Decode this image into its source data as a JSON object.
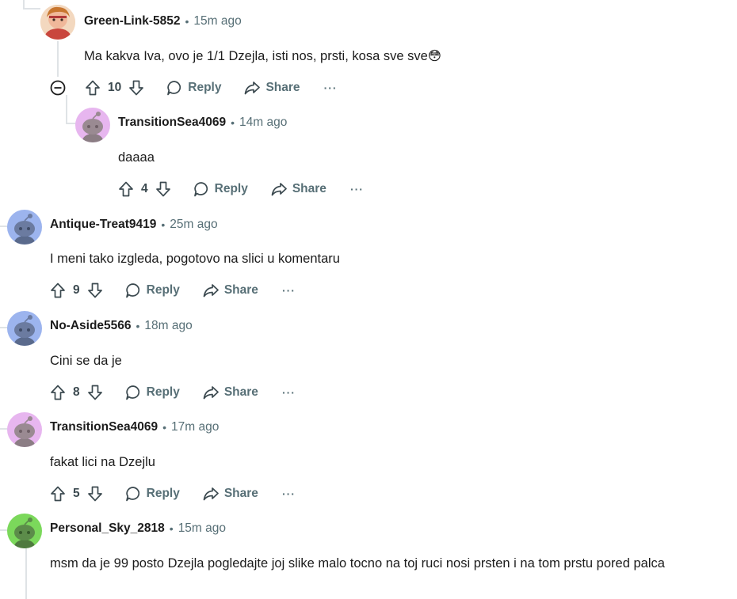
{
  "comments": [
    {
      "username": "Green-Link-5852",
      "time": "15m ago",
      "text": "Ma kakva Iva, ovo je 1/1 Dzejla, isti nos, prsti, kosa sve sve😳",
      "votes": "10",
      "avatar_color": "#f0c9a4"
    },
    {
      "username": "TransitionSea4069",
      "time": "14m ago",
      "text": "daaaa",
      "votes": "4",
      "avatar_color": "#e7b6ef"
    },
    {
      "username": "Antique-Treat9419",
      "time": "25m ago",
      "text": "I meni tako izgleda, pogotovo na slici u komentaru",
      "votes": "9",
      "avatar_color": "#9cb4ee"
    },
    {
      "username": "No-Aside5566",
      "time": "18m ago",
      "text": "Cini se da je",
      "votes": "8",
      "avatar_color": "#9cb4ee"
    },
    {
      "username": "TransitionSea4069",
      "time": "17m ago",
      "text": "fakat lici na Dzejlu",
      "votes": "5",
      "avatar_color": "#e7b6ef"
    },
    {
      "username": "Personal_Sky_2818",
      "time": "15m ago",
      "text": "msm da je 99 posto Dzejla pogledajte joj slike malo tocno na toj ruci nosi prsten i na tom prstu pored palca",
      "avatar_color": "#7bd85b"
    }
  ],
  "labels": {
    "dot": "•",
    "reply": "Reply",
    "share": "Share",
    "more": "···"
  },
  "icons": [
    "collapse-icon",
    "upvote-icon",
    "downvote-icon",
    "reply-icon",
    "share-icon",
    "more-icon",
    "snoo-avatar-icon"
  ]
}
